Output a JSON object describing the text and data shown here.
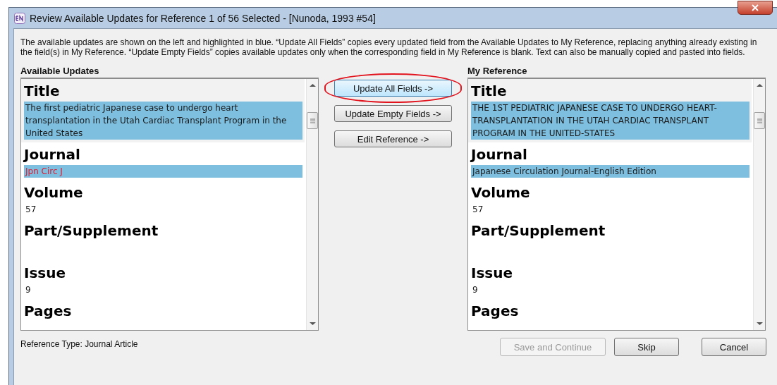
{
  "window": {
    "title": "Review Available Updates for Reference 1 of 56 Selected - [Nunoda, 1993 #54]"
  },
  "description": "The available updates are shown on the left and highlighted in blue. “Update All Fields” copies every updated field from the Available Updates to My Reference, replacing anything already existing in the field(s) in My Reference. “Update Empty Fields” copies available updates only when the corresponding field in My Reference is blank. Text can also be manually copied and pasted into fields.",
  "panels": [
    {
      "heading": "Available Updates",
      "fields": [
        {
          "label": "Title",
          "value": "The first pediatric Japanese case to undergo heart transplantation in the Utah Cardiac Transplant Program in the United States",
          "highlighted": true,
          "changed": false
        },
        {
          "label": "Journal",
          "value": "Jpn Circ J",
          "highlighted": true,
          "changed": true
        },
        {
          "label": "Volume",
          "value": "57",
          "highlighted": false,
          "changed": false
        },
        {
          "label": "Part/Supplement"
        },
        {
          "label": "Issue",
          "value": "9",
          "highlighted": false,
          "changed": false
        },
        {
          "label": "Pages"
        }
      ]
    },
    {
      "heading": "My Reference",
      "fields": [
        {
          "label": "Title",
          "value": "THE 1ST PEDIATRIC JAPANESE CASE TO UNDERGO HEART-TRANSPLANTATION IN THE UTAH CARDIAC TRANSPLANT PROGRAM IN THE UNITED-STATES",
          "highlighted": true,
          "changed": false
        },
        {
          "label": "Journal",
          "value": "Japanese Circulation Journal-English Edition",
          "highlighted": true,
          "changed": false
        },
        {
          "label": "Volume",
          "value": "57",
          "highlighted": false,
          "changed": false
        },
        {
          "label": "Part/Supplement"
        },
        {
          "label": "Issue",
          "value": "9",
          "highlighted": false,
          "changed": false
        },
        {
          "label": "Pages"
        }
      ]
    }
  ],
  "actions": [
    {
      "label": "Update All Fields ->",
      "circled": true
    },
    {
      "label": "Update Empty Fields ->",
      "circled": false
    },
    {
      "label": "Edit Reference ->",
      "circled": false
    }
  ],
  "reference_type": "Reference Type: Journal Article",
  "buttons": [
    {
      "label": "Save and Continue",
      "disabled": true
    },
    {
      "label": "Skip",
      "disabled": false
    },
    {
      "label": "Cancel",
      "disabled": false
    }
  ]
}
